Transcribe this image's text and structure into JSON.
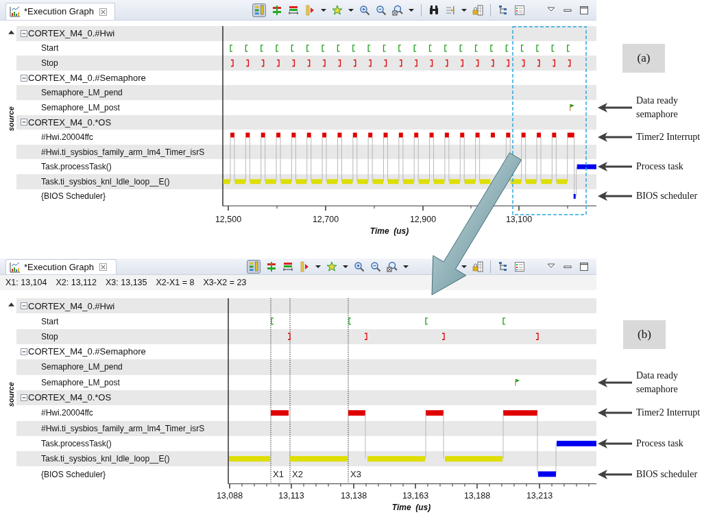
{
  "graphs": [
    {
      "kind": "overview",
      "tab": {
        "title": "*Execution Graph"
      },
      "toolbar": {
        "toggle": {
          "on": true
        }
      },
      "axis_label": "source",
      "figure_label": "(a)",
      "rows": [
        {
          "label": "CORTEX_M4_0.#Hwi",
          "expanded": true,
          "children": [
            {
              "label": "Start"
            },
            {
              "label": "Stop"
            }
          ]
        },
        {
          "label": "CORTEX_M4_0.#Semaphore",
          "expanded": true,
          "children": [
            {
              "label": "Semaphore_LM_pend"
            },
            {
              "label": "Semaphore_LM_post",
              "annotation": "Data ready semaphore"
            }
          ]
        },
        {
          "label": "CORTEX_M4_0.*OS",
          "expanded": true,
          "children": [
            {
              "label": "#Hwi.20004ffc",
              "annotation": "Timer2 Interrupt"
            },
            {
              "label": "#Hwi.ti_sysbios_family_arm_lm4_Timer_isrS"
            },
            {
              "label": "Task.processTask()",
              "annotation": "Process task"
            },
            {
              "label": "Task.ti_sysbios_knl_Idle_loop__E()"
            },
            {
              "label": "{BIOS Scheduler}",
              "annotation": "BIOS scheduler"
            }
          ]
        }
      ],
      "x_ticks": [
        "12,500",
        "12,700",
        "12,900",
        "13,100"
      ],
      "x_title": "Time  (us)"
    },
    {
      "kind": "zoomed",
      "tab": {
        "title": "*Execution Graph"
      },
      "toolbar": {
        "toggle": {
          "on": true
        }
      },
      "cursor_readouts": [
        "X1: 13,104",
        "X2: 13,112",
        "X3: 13,135",
        "X2-X1 = 8",
        "X3-X2 = 23"
      ],
      "axis_label": "source",
      "figure_label": "(b)",
      "rows": [
        {
          "label": "CORTEX_M4_0.#Hwi",
          "expanded": true,
          "children": [
            {
              "label": "Start"
            },
            {
              "label": "Stop"
            }
          ]
        },
        {
          "label": "CORTEX_M4_0.#Semaphore",
          "expanded": true,
          "children": [
            {
              "label": "Semaphore_LM_pend"
            },
            {
              "label": "Semaphore_LM_post",
              "annotation": "Data ready semaphore"
            }
          ]
        },
        {
          "label": "CORTEX_M4_0.*OS",
          "expanded": true,
          "children": [
            {
              "label": "#Hwi.20004ffc",
              "annotation": "Timer2 Interrupt"
            },
            {
              "label": "#Hwi.ti_sysbios_family_arm_lm4_Timer_isrS"
            },
            {
              "label": "Task.processTask()",
              "annotation": "Process task"
            },
            {
              "label": "Task.ti_sysbios_knl_Idle_loop__E()"
            },
            {
              "label": "{BIOS Scheduler}",
              "annotation": "BIOS scheduler"
            }
          ]
        }
      ],
      "markers": [
        {
          "label": "X1"
        },
        {
          "label": "X2"
        },
        {
          "label": "X3"
        }
      ],
      "x_ticks": [
        "13,088",
        "13,113",
        "13,138",
        "13,163",
        "13,188",
        "13,213"
      ],
      "x_title": "Time  (us)"
    }
  ]
}
